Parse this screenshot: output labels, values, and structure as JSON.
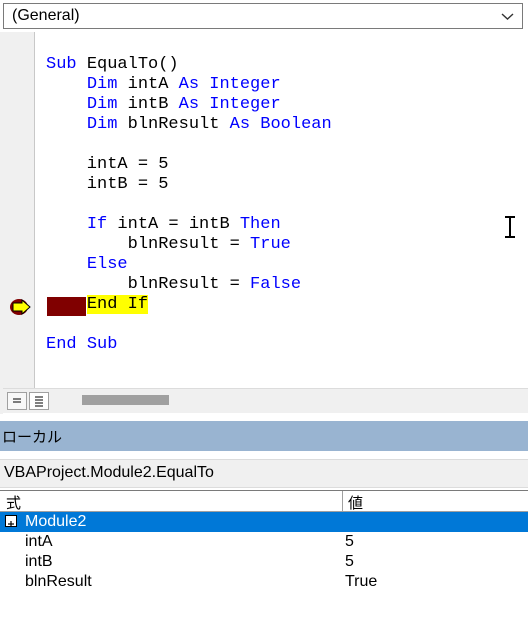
{
  "object_dropdown": {
    "value": "(General)"
  },
  "code": {
    "lines": [
      {
        "parts": [
          {
            "t": "Sub ",
            "kw": true
          },
          {
            "t": "EqualTo()",
            "kw": false
          }
        ]
      },
      {
        "parts": [
          {
            "t": "    ",
            "kw": false
          },
          {
            "t": "Dim ",
            "kw": true
          },
          {
            "t": "intA ",
            "kw": false
          },
          {
            "t": "As ",
            "kw": true
          },
          {
            "t": "Integer",
            "kw": true
          }
        ]
      },
      {
        "parts": [
          {
            "t": "    ",
            "kw": false
          },
          {
            "t": "Dim ",
            "kw": true
          },
          {
            "t": "intB ",
            "kw": false
          },
          {
            "t": "As ",
            "kw": true
          },
          {
            "t": "Integer",
            "kw": true
          }
        ]
      },
      {
        "parts": [
          {
            "t": "    ",
            "kw": false
          },
          {
            "t": "Dim ",
            "kw": true
          },
          {
            "t": "blnResult ",
            "kw": false
          },
          {
            "t": "As ",
            "kw": true
          },
          {
            "t": "Boolean",
            "kw": true
          }
        ]
      },
      {
        "parts": []
      },
      {
        "parts": [
          {
            "t": "    intA = 5",
            "kw": false
          }
        ]
      },
      {
        "parts": [
          {
            "t": "    intB = 5",
            "kw": false
          }
        ]
      },
      {
        "parts": []
      },
      {
        "parts": [
          {
            "t": "    ",
            "kw": false
          },
          {
            "t": "If ",
            "kw": true
          },
          {
            "t": "intA = intB ",
            "kw": false
          },
          {
            "t": "Then",
            "kw": true
          }
        ]
      },
      {
        "parts": [
          {
            "t": "        blnResult = ",
            "kw": false
          },
          {
            "t": "True",
            "kw": true
          }
        ]
      },
      {
        "parts": [
          {
            "t": "    ",
            "kw": false
          },
          {
            "t": "Else",
            "kw": true
          }
        ]
      },
      {
        "parts": [
          {
            "t": "        blnResult = ",
            "kw": false
          },
          {
            "t": "False",
            "kw": true
          }
        ]
      },
      {
        "parts": [
          {
            "t": "    ",
            "kw": false
          },
          {
            "t": "End If",
            "kw": false,
            "exec": true
          }
        ],
        "current": true
      },
      {
        "parts": []
      },
      {
        "parts": [
          {
            "t": "End ",
            "kw": true
          },
          {
            "t": "Sub",
            "kw": true
          }
        ]
      }
    ]
  },
  "locals": {
    "title": "ローカル",
    "context": "VBAProject.Module2.EqualTo",
    "headers": {
      "expression": "式",
      "value": "値"
    },
    "rows": [
      {
        "name": "Module2",
        "value": "",
        "selected": true,
        "expandable": true
      },
      {
        "name": "intA",
        "value": "5"
      },
      {
        "name": "intB",
        "value": "5"
      },
      {
        "name": "blnResult",
        "value": "True"
      }
    ]
  },
  "colors": {
    "keyword": "#0000ff",
    "exec_highlight": "#ffff00",
    "breakpoint": "#800000",
    "title_bar": "#99b4d1",
    "selection": "#0078d7"
  }
}
